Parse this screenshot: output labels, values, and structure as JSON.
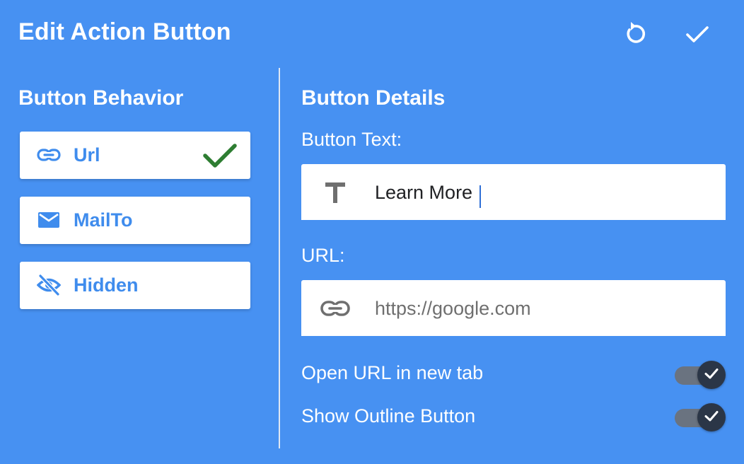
{
  "header": {
    "title": "Edit Action Button",
    "reset_icon": "reset-icon",
    "confirm_icon": "check-icon"
  },
  "behavior": {
    "title": "Button Behavior",
    "options": [
      {
        "label": "Url",
        "icon": "link-icon",
        "selected": true
      },
      {
        "label": "MailTo",
        "icon": "mail-icon",
        "selected": false
      },
      {
        "label": "Hidden",
        "icon": "eye-off-icon",
        "selected": false
      }
    ]
  },
  "details": {
    "title": "Button Details",
    "button_text_label": "Button Text:",
    "button_text_value": "Learn More",
    "url_label": "URL:",
    "url_value": "",
    "url_placeholder": "https://google.com",
    "toggles": [
      {
        "label": "Open URL in new tab",
        "checked": true
      },
      {
        "label": "Show Outline Button",
        "checked": true
      }
    ]
  },
  "colors": {
    "background": "#4791f2",
    "accent_text": "#3f8ced",
    "check_green": "#2e7d32",
    "switch_thumb": "#2b3647",
    "switch_track": "#6a7380"
  }
}
